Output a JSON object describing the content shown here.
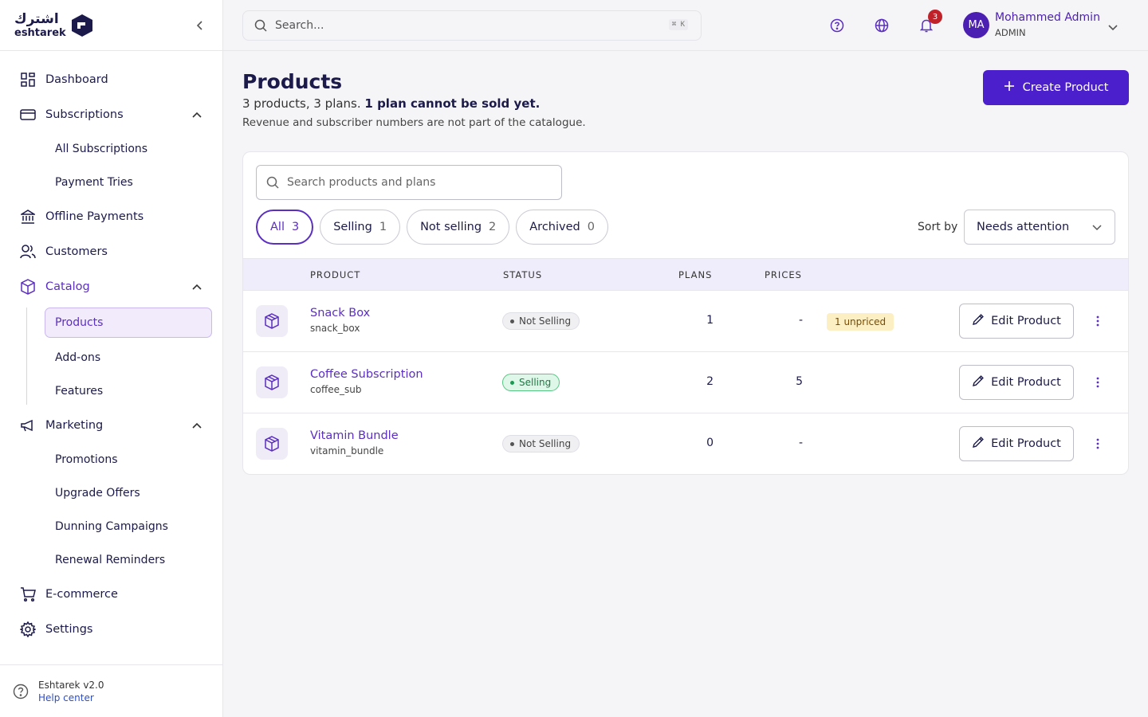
{
  "brand": {
    "arabic": "اشترك",
    "latin": "eshtarek",
    "accent": "#5b2fbf"
  },
  "sidebar": {
    "nav": [
      {
        "label": "Dashboard",
        "icon": "dashboard-icon"
      },
      {
        "label": "Subscriptions",
        "icon": "card-icon",
        "sub": [
          "All Subscriptions",
          "Payment Tries"
        ]
      },
      {
        "label": "Offline Payments",
        "icon": "bank-icon"
      },
      {
        "label": "Customers",
        "icon": "users-icon"
      },
      {
        "label": "Catalog",
        "icon": "box-icon",
        "sub": [
          "Products",
          "Add-ons",
          "Features"
        ]
      },
      {
        "label": "Marketing",
        "icon": "megaphone-icon",
        "sub": [
          "Promotions",
          "Upgrade Offers",
          "Dunning Campaigns",
          "Renewal Reminders"
        ]
      },
      {
        "label": "E-commerce",
        "icon": "cart-icon"
      },
      {
        "label": "Settings",
        "icon": "gear-icon"
      }
    ],
    "footer": {
      "version": "Eshtarek v2.0",
      "help": "Help center"
    }
  },
  "topbar": {
    "search_placeholder": "Search...",
    "shortcut": "⌘ K",
    "notifications": "3",
    "user": {
      "initials": "MA",
      "name": "Mohammed Admin",
      "role": "ADMIN"
    }
  },
  "page": {
    "title": "Products",
    "summary_plain": "3 products, 3 plans. ",
    "summary_bold": "1 plan cannot be sold yet.",
    "note": "Revenue and subscriber numbers are not part of the catalogue.",
    "create_label": "Create Product"
  },
  "card": {
    "search_placeholder": "Search products and plans",
    "filters": [
      {
        "label": "All",
        "count": "3"
      },
      {
        "label": "Selling",
        "count": "1"
      },
      {
        "label": "Not selling",
        "count": "2"
      },
      {
        "label": "Archived",
        "count": "0"
      }
    ],
    "sort_label": "Sort by",
    "sort_value": "Needs attention",
    "columns": [
      "PRODUCT",
      "STATUS",
      "PLANS",
      "PRICES"
    ],
    "rows": [
      {
        "name": "Snack Box",
        "key": "snack_box",
        "status": "Not Selling",
        "plans": "1",
        "prices": "-",
        "flag": "1 unpriced",
        "edit": "Edit Product"
      },
      {
        "name": "Coffee Subscription",
        "key": "coffee_sub",
        "status": "Selling",
        "plans": "2",
        "prices": "5",
        "flag": "",
        "edit": "Edit Product"
      },
      {
        "name": "Vitamin Bundle",
        "key": "vitamin_bundle",
        "status": "Not Selling",
        "plans": "0",
        "prices": "-",
        "flag": "",
        "edit": "Edit Product"
      }
    ]
  }
}
